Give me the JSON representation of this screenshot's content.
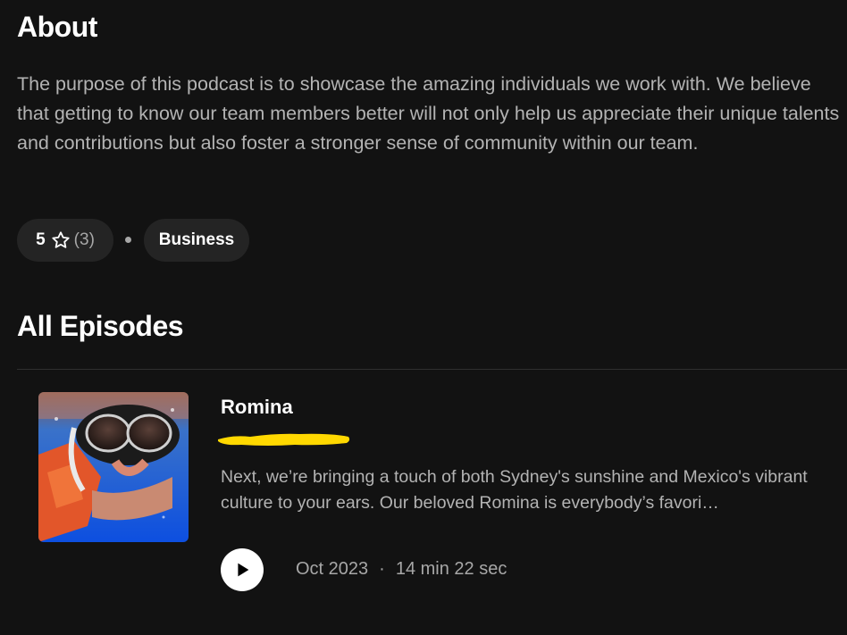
{
  "about": {
    "heading": "About",
    "description": "The purpose of this podcast is to showcase the amazing individuals we work with. We believe that getting to know our team members better will not only help us appreciate their unique talents and contributions but also foster a stronger sense of community within our team."
  },
  "rating": {
    "value": "5",
    "icon": "star-outline-icon",
    "count": "(3)"
  },
  "category": {
    "label": "Business"
  },
  "episodes": {
    "heading": "All Episodes",
    "items": [
      {
        "title": "Romina",
        "description": "Next, we’re bringing a touch of both Sydney's sunshine and Mexico's vibrant culture to your ears. Our beloved Romina is everybody’s favori…",
        "date": "Oct 2023",
        "separator": "·",
        "duration": "14 min 22 sec",
        "play_icon": "play-icon"
      }
    ]
  },
  "colors": {
    "background": "#121212",
    "pill": "#242424",
    "text_secondary": "#b3b3b3",
    "highlight": "#ffd800"
  }
}
